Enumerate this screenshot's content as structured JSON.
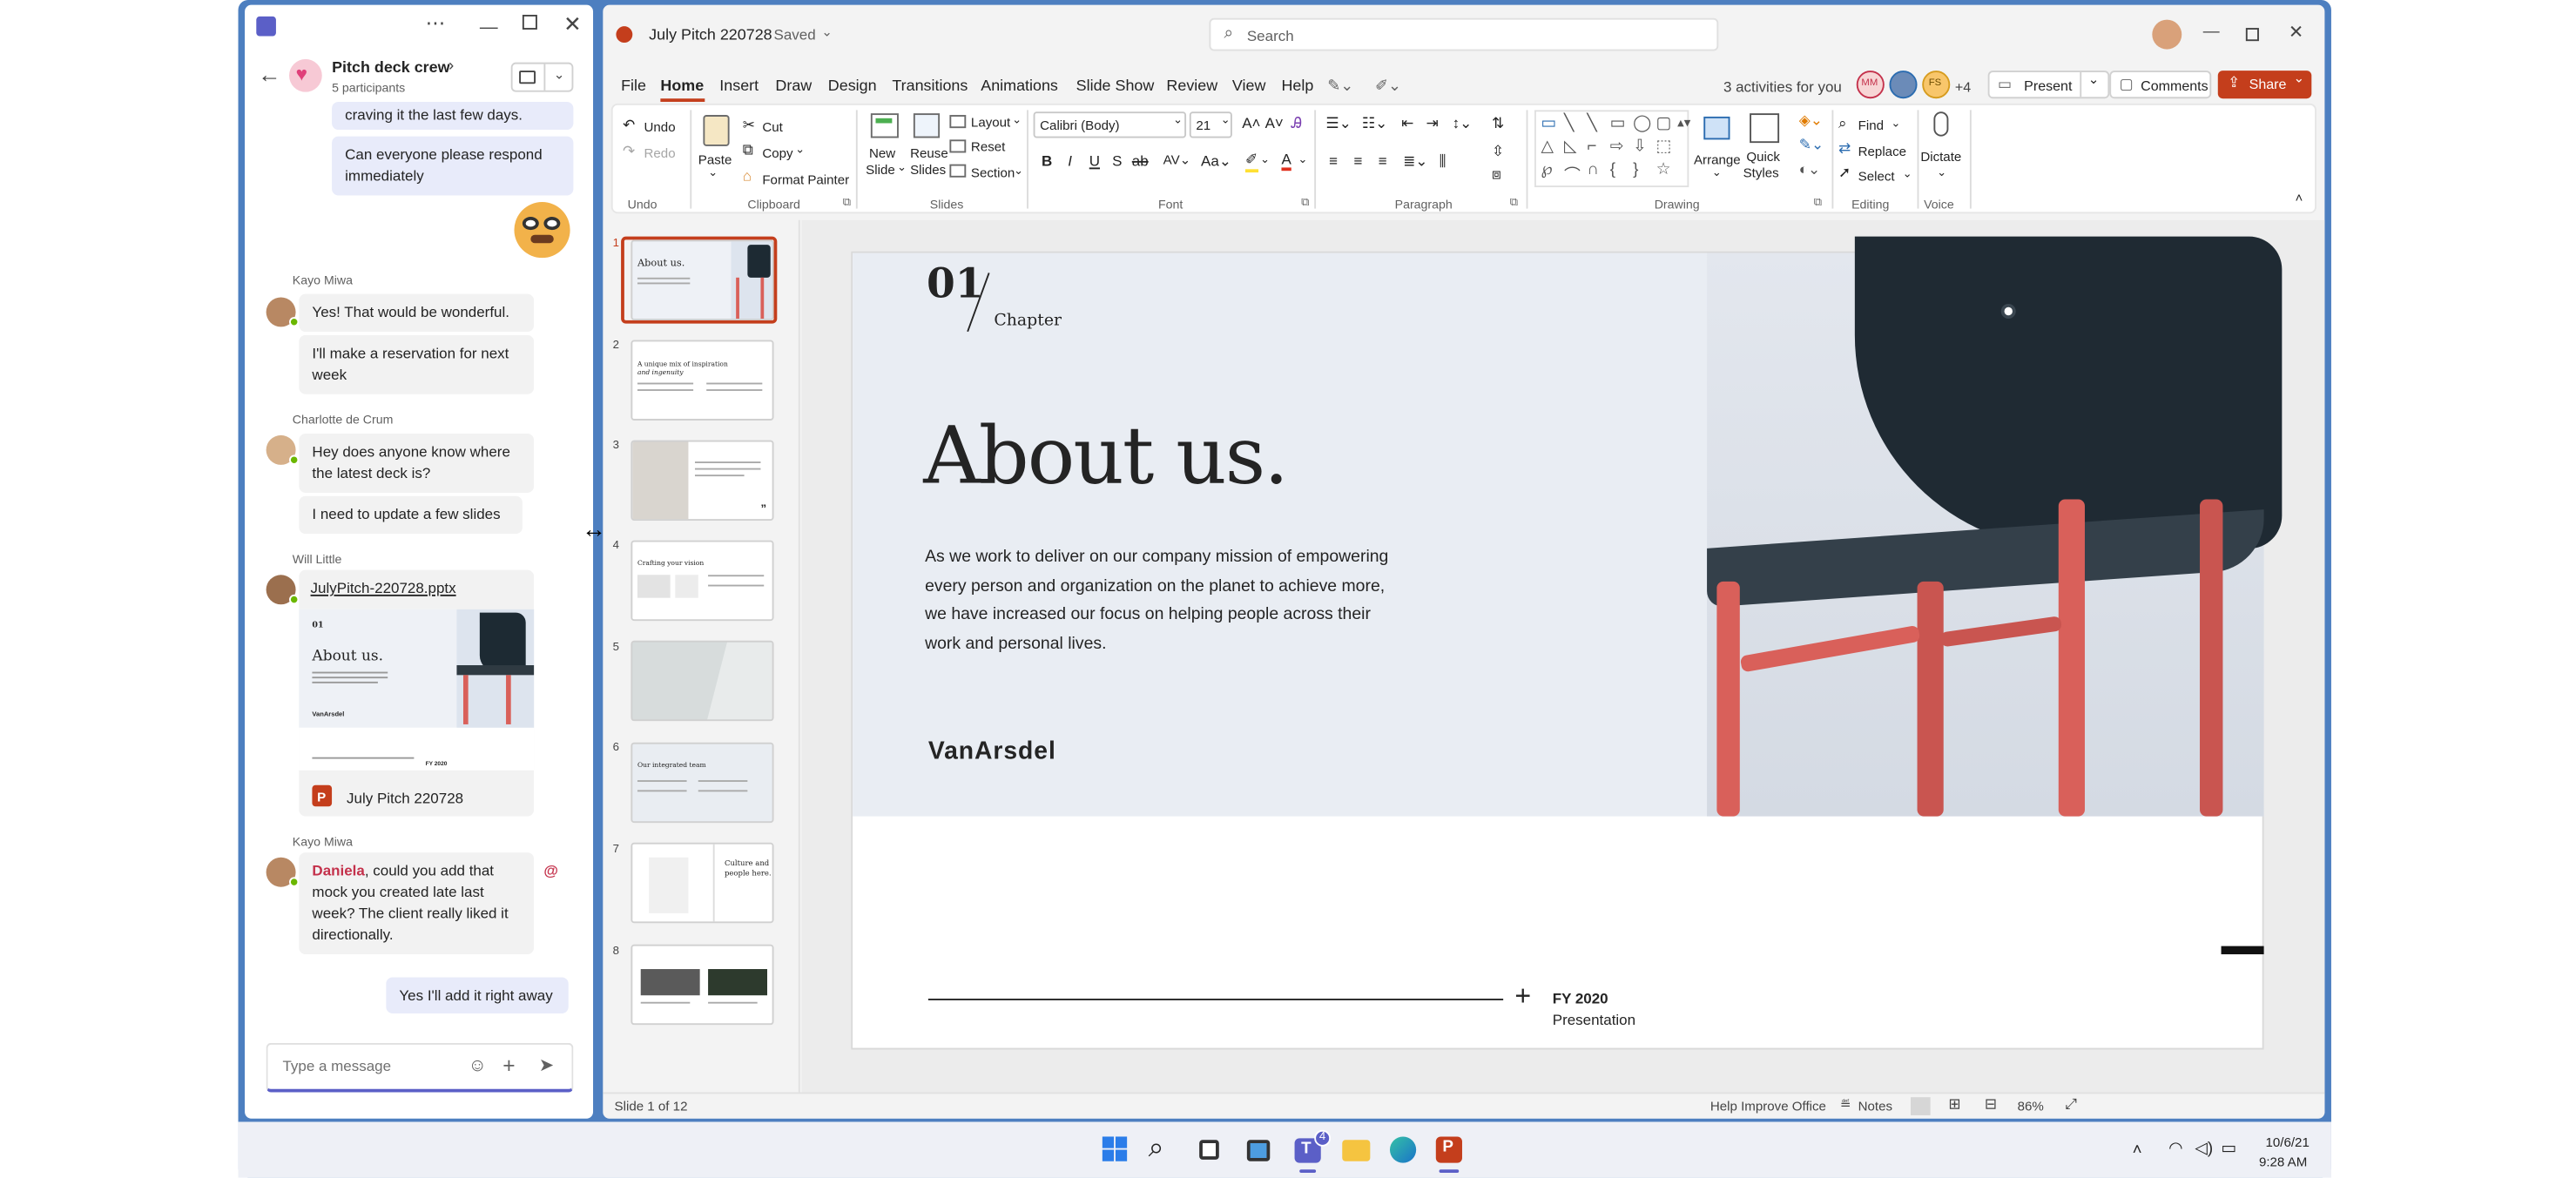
{
  "teams": {
    "chat_title": "Pitch deck crew",
    "chevron": "›",
    "participants": "5 participants",
    "messages": {
      "m0": "craving it the last few days.",
      "m1": "Can everyone please respond immediately",
      "kayo1_name": "Kayo Miwa",
      "kayo1_a": "Yes! That would be wonderful.",
      "kayo1_b": "I'll make a reservation for next week",
      "charlotte_name": "Charlotte de Crum",
      "charlotte_a": "Hey does anyone know where the latest deck is?",
      "charlotte_b": "I need to update a few slides",
      "will_name": "Will Little",
      "file_link": "JulyPitch-220728.pptx",
      "file_card_title": "July Pitch 220728",
      "preview_num": "01",
      "preview_title": "About us.",
      "preview_logo": "VanArsdel",
      "preview_fy": "FY 2020",
      "kayo2_name": "Kayo Miwa",
      "kayo2_mention": "Daniela",
      "kayo2_text": ", could you add that mock you created late last week? The client really liked it directionally.",
      "at_sign": "@",
      "reply": "Yes I'll add it right away"
    },
    "compose_placeholder": "Type a message"
  },
  "ppt": {
    "doc_title": "July Pitch 220728",
    "saved": "Saved",
    "search_placeholder": "Search",
    "menu": [
      "File",
      "Home",
      "Insert",
      "Draw",
      "Design",
      "Transitions",
      "Animations",
      "Slide Show",
      "Review",
      "View",
      "Help"
    ],
    "activities": "3 activities for you",
    "collab": [
      "MM",
      "FS"
    ],
    "collab_more": "+4",
    "present": "Present",
    "comments": "Comments",
    "share": "Share",
    "ribbon": {
      "undo": "Undo",
      "redo": "Redo",
      "paste": "Paste",
      "cut": "Cut",
      "copy": "Copy",
      "format_painter": "Format Painter",
      "new_slide_1": "New",
      "new_slide_2": "Slide",
      "reuse_1": "Reuse",
      "reuse_2": "Slides",
      "layout": "Layout",
      "reset": "Reset",
      "section": "Section",
      "font_name": "Calibri (Body)",
      "font_size": "21",
      "arrange": "Arrange",
      "quick_styles_1": "Quick",
      "quick_styles_2": "Styles",
      "find": "Find",
      "replace": "Replace",
      "select": "Select",
      "dictate": "Dictate",
      "groups": [
        "Undo",
        "Clipboard",
        "Slides",
        "Font",
        "Paragraph",
        "Drawing",
        "Editing",
        "Voice"
      ]
    },
    "thumb_numbers": [
      "1",
      "2",
      "3",
      "4",
      "5",
      "6",
      "7",
      "8"
    ],
    "thumb_texts": {
      "t1": "About us.",
      "t2a": "A unique mix of inspiration",
      "t2b": "and ingenuity",
      "t4": "Crafting your vision",
      "t6": "Our integrated team",
      "t7a": "Culture and",
      "t7b": "people here."
    },
    "slide": {
      "num": "01",
      "chapter": "Chapter",
      "title": "About us.",
      "body": "As we work to deliver on our company mission of empowering every person and organization on the planet to achieve more, we have increased our focus on helping people across their work and personal lives.",
      "logo": "VanArsdel",
      "fy": "FY 2020",
      "presentation": "Presentation"
    },
    "status": {
      "slide_of": "Slide 1 of 12",
      "help": "Help Improve Office",
      "notes": "Notes",
      "zoom": "86%"
    }
  },
  "taskbar": {
    "teams_badge": "4",
    "date": "10/6/21",
    "time": "9:28 AM"
  },
  "colors": {
    "teams_purple": "#5b5fc7",
    "ppt_orange": "#c43e1c",
    "chair_red": "#d9605a",
    "desktop": "#4d7fc0"
  }
}
